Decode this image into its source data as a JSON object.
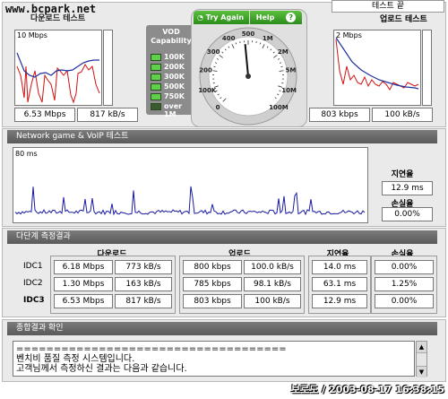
{
  "watermark": "www.bcpark.net",
  "download_title": "다운로드 테스트",
  "upload_title": "업로드 테스트",
  "test_end_tab": "테스트 끝",
  "download": {
    "scale": "10 Mbps",
    "mbps": "6.53 Mbps",
    "kbs": "817 kB/s"
  },
  "upload": {
    "scale": "2 Mbps",
    "kbps": "803 kbps",
    "kbs": "100 kB/s"
  },
  "vod": {
    "title": "VOD\nCapability",
    "levels": [
      "100K",
      "200K",
      "300K",
      "500K",
      "750K",
      "over 1M"
    ],
    "lit": [
      true,
      true,
      true,
      true,
      true,
      false
    ]
  },
  "gauge": {
    "try_again": "Try Again",
    "help": "Help",
    "help_icon": "?",
    "ticks": [
      "0",
      "100K",
      "200",
      "300",
      "400",
      "500",
      "1M",
      "2M",
      "5M",
      "10M",
      "100M"
    ],
    "needle_fraction": 0.48
  },
  "network": {
    "title": "Network game & VoIP 테스트",
    "scale": "80 ms",
    "latency_label": "지연율",
    "latency": "12.9 ms",
    "loss_label": "손실율",
    "loss": "0.00%"
  },
  "multi": {
    "title": "다단계 측정결과",
    "headers": {
      "download": "다운로드",
      "upload": "업로드",
      "latency": "지연율",
      "loss": "손실율"
    },
    "rows": [
      {
        "name": "IDC1",
        "dl_mbps": "6.18 Mbps",
        "dl_kbs": "773 kB/s",
        "ul_kbps": "800 kbps",
        "ul_kbs": "100.0 kB/s",
        "lat": "14.0 ms",
        "loss": "0.00%"
      },
      {
        "name": "IDC2",
        "dl_mbps": "1.30 Mbps",
        "dl_kbs": "163 kB/s",
        "ul_kbps": "785 kbps",
        "ul_kbs": "98.1 kB/s",
        "lat": "63.1 ms",
        "loss": "1.25%"
      },
      {
        "name": "IDC3",
        "dl_mbps": "6.53 Mbps",
        "dl_kbs": "817 kB/s",
        "ul_kbps": "803 kbps",
        "ul_kbs": "100 kB/s",
        "lat": "12.9 ms",
        "loss": "0.00%"
      }
    ]
  },
  "summary": {
    "title": "종합결과 확인",
    "lines": [
      "====================================",
      "벤치비 품질 측정 시스템입니다.",
      "고객님께서 측정하신 결과는 다음과 같습니다."
    ]
  },
  "footer": "보로도 / 2003-08-17 16:38:15"
}
